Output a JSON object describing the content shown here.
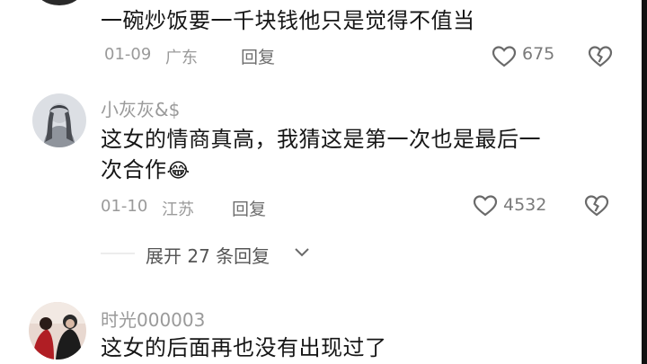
{
  "comment1": {
    "text": "一碗炒饭要一千块钱他只是觉得不值当",
    "date": "01-09",
    "location": "广东",
    "reply_label": "回复",
    "likes": "675"
  },
  "comment2": {
    "username": "小灰灰&$",
    "text_line1": "这女的情商真高，我猜这是第一次也是最后一",
    "text_line2": "次合作",
    "emoji": "😂",
    "date": "01-10",
    "location": "江苏",
    "reply_label": "回复",
    "likes": "4532",
    "expand_label": "展开 27 条回复"
  },
  "comment3": {
    "username": "时光000003",
    "text": "这女的后面再也没有出现过了"
  },
  "colors": {
    "meta": "#9a9a9a",
    "text": "#161616",
    "divider": "#ececec"
  },
  "icons": [
    "heart-outline-icon",
    "broken-heart-icon",
    "chevron-down-icon"
  ]
}
